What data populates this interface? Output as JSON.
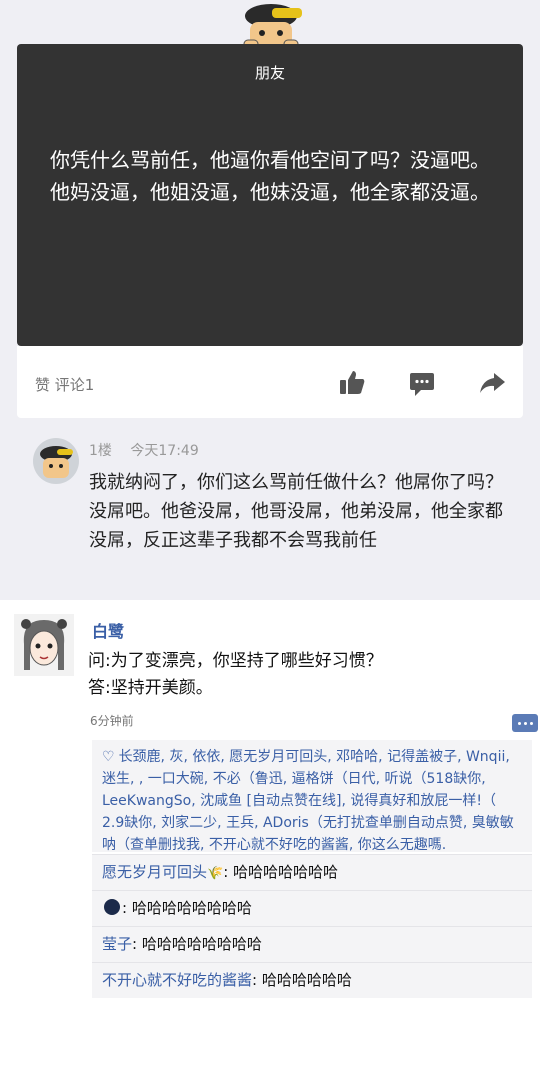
{
  "card": {
    "title": "朋友",
    "text": "你凭什么骂前任，他逼你看他空间了吗？没逼吧。他妈没逼，他姐没逼，他妹没逼，他全家都没逼。"
  },
  "actions": {
    "stats": "赞 评论1",
    "like_icon": "thumbs-up-icon",
    "comment_icon": "comment-bubble-icon",
    "share_icon": "share-arrow-icon"
  },
  "comment": {
    "floor": "1楼",
    "time": "今天17:49",
    "text": "我就纳闷了，你们这么骂前任做什么？他屌你了吗？没屌吧。他爸没屌，他哥没屌，他弟没屌，他全家都没屌，反正这辈子我都不会骂我前任"
  },
  "qq_post": {
    "name": "白鹭",
    "question": "问:为了变漂亮，你坚持了哪些好习惯？",
    "answer": "答:坚持开美颜。",
    "time": "6分钟前",
    "likes": "长颈鹿, 灰, 依依, 愿无岁月可回头, 邓哈哈,  记得盖被子, Wnqii, 迷生, , 一口大碗, 不必（鲁迅, 逼格饼（日代, 听说（518缺你, LeeKwangSo, 沈咸鱼 [自动点赞在线], 说得真好和放屁一样!（ 2.9缺你, 刘家二少, 王兵, ADoris（无打扰查单删自动点赞, 臭敏敏呐（查单删找我, 不开心就不好吃的酱酱, 你这么无趣嗎."
  },
  "replies": [
    {
      "name": "愿无岁月可回头",
      "text": ": 哈哈哈哈哈哈哈"
    },
    {
      "name": "",
      "text": ": 哈哈哈哈哈哈哈哈"
    },
    {
      "name": "莹子",
      "text": ": 哈哈哈哈哈哈哈哈"
    },
    {
      "name": "不开心就不好吃的酱酱",
      "text": ": 哈哈哈哈哈哈"
    }
  ]
}
